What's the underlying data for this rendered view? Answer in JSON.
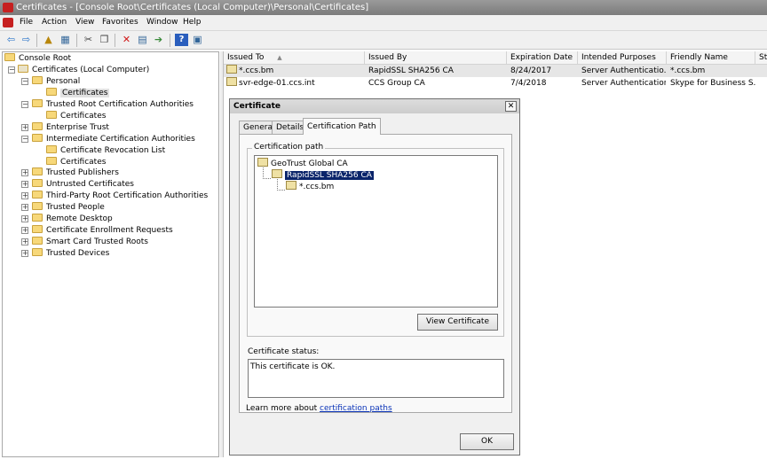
{
  "window": {
    "title": "Certificates - [Console Root\\Certificates (Local Computer)\\Personal\\Certificates]"
  },
  "menu": [
    "File",
    "Action",
    "View",
    "Favorites",
    "Window",
    "Help"
  ],
  "toolbar": [
    "back-icon",
    "forward-icon",
    "up-folder-icon",
    "show-hide-tree-icon",
    "cut-icon",
    "copy-icon",
    "delete-icon",
    "properties-icon",
    "export-list-icon",
    "help-icon",
    "mmc-pane-icon"
  ],
  "tree": [
    {
      "label": "Console Root",
      "level": 0,
      "expander": ""
    },
    {
      "label": "Certificates (Local Computer)",
      "level": 1,
      "expander": "−"
    },
    {
      "label": "Personal",
      "level": 2,
      "expander": "−"
    },
    {
      "label": "Certificates",
      "level": 3,
      "expander": "",
      "selected": true
    },
    {
      "label": "Trusted Root Certification Authorities",
      "level": 2,
      "expander": "−"
    },
    {
      "label": "Certificates",
      "level": 3,
      "expander": ""
    },
    {
      "label": "Enterprise Trust",
      "level": 2,
      "expander": "+"
    },
    {
      "label": "Intermediate Certification Authorities",
      "level": 2,
      "expander": "−"
    },
    {
      "label": "Certificate Revocation List",
      "level": 3,
      "expander": ""
    },
    {
      "label": "Certificates",
      "level": 3,
      "expander": ""
    },
    {
      "label": "Trusted Publishers",
      "level": 2,
      "expander": "+"
    },
    {
      "label": "Untrusted Certificates",
      "level": 2,
      "expander": "+"
    },
    {
      "label": "Third-Party Root Certification Authorities",
      "level": 2,
      "expander": "+"
    },
    {
      "label": "Trusted People",
      "level": 2,
      "expander": "+"
    },
    {
      "label": "Remote Desktop",
      "level": 2,
      "expander": "+"
    },
    {
      "label": "Certificate Enrollment Requests",
      "level": 2,
      "expander": "+"
    },
    {
      "label": "Smart Card Trusted Roots",
      "level": 2,
      "expander": "+"
    },
    {
      "label": "Trusted Devices",
      "level": 2,
      "expander": "+"
    }
  ],
  "list": {
    "columns": [
      "Issued To",
      "Issued By",
      "Expiration Date",
      "Intended Purposes",
      "Friendly Name",
      "St"
    ],
    "sort_indicator": "▲",
    "rows": [
      {
        "issued_to": "*.ccs.bm",
        "issued_by": "RapidSSL SHA256 CA",
        "expiration": "8/24/2017",
        "purposes": "Server Authenticatio...",
        "friendly": "*.ccs.bm",
        "selected": true
      },
      {
        "issued_to": "svr-edge-01.ccs.int",
        "issued_by": "CCS Group CA",
        "expiration": "7/4/2018",
        "purposes": "Server Authentication",
        "friendly": "Skype for Business S...",
        "selected": false
      }
    ]
  },
  "dialog": {
    "title": "Certificate",
    "close": "✕",
    "tabs": [
      "General",
      "Details",
      "Certification Path"
    ],
    "active_tab": "Certification Path",
    "path_group_label": "Certification path",
    "path": [
      {
        "label": "GeoTrust Global CA",
        "level": 0
      },
      {
        "label": "RapidSSL SHA256 CA",
        "level": 1,
        "selected": true
      },
      {
        "label": "*.ccs.bm",
        "level": 2
      }
    ],
    "view_button": "View Certificate",
    "status_label": "Certificate status:",
    "status_text": "This certificate is OK.",
    "learn_prefix": "Learn more about ",
    "learn_link": "certification paths",
    "ok_button": "OK"
  },
  "colors": {
    "selection_navy": "#0a246a",
    "folder_yellow": "#f7d87a",
    "title_grey": "#8a8a8a"
  }
}
